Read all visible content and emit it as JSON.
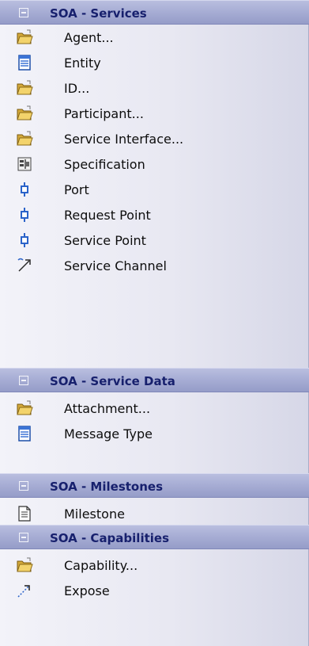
{
  "groups": [
    {
      "title": "SOA - Services",
      "items": [
        {
          "label": "Agent...",
          "icon": "folder-icon"
        },
        {
          "label": "Entity",
          "icon": "entity-icon"
        },
        {
          "label": "ID...",
          "icon": "folder-icon"
        },
        {
          "label": "Participant...",
          "icon": "folder-icon"
        },
        {
          "label": "Service Interface...",
          "icon": "folder-icon"
        },
        {
          "label": "Specification",
          "icon": "specification-icon"
        },
        {
          "label": "Port",
          "icon": "port-icon"
        },
        {
          "label": "Request Point",
          "icon": "port-icon"
        },
        {
          "label": "Service Point",
          "icon": "port-icon"
        },
        {
          "label": "Service Channel",
          "icon": "channel-icon"
        }
      ]
    },
    {
      "title": "SOA - Service Data",
      "items": [
        {
          "label": "Attachment...",
          "icon": "folder-icon"
        },
        {
          "label": "Message Type",
          "icon": "entity-icon"
        }
      ]
    },
    {
      "title": "SOA - Milestones",
      "items": [
        {
          "label": "Milestone",
          "icon": "document-icon"
        }
      ]
    },
    {
      "title": "SOA - Capabilities",
      "items": [
        {
          "label": "Capability...",
          "icon": "folder-icon"
        },
        {
          "label": "Expose",
          "icon": "dependency-arrow-icon"
        }
      ]
    }
  ],
  "colors": {
    "header_text": "#17206d",
    "header_bg": "#a8aed5",
    "panel_bg": "#e8e8f2",
    "item_text": "#0d0d0d"
  }
}
